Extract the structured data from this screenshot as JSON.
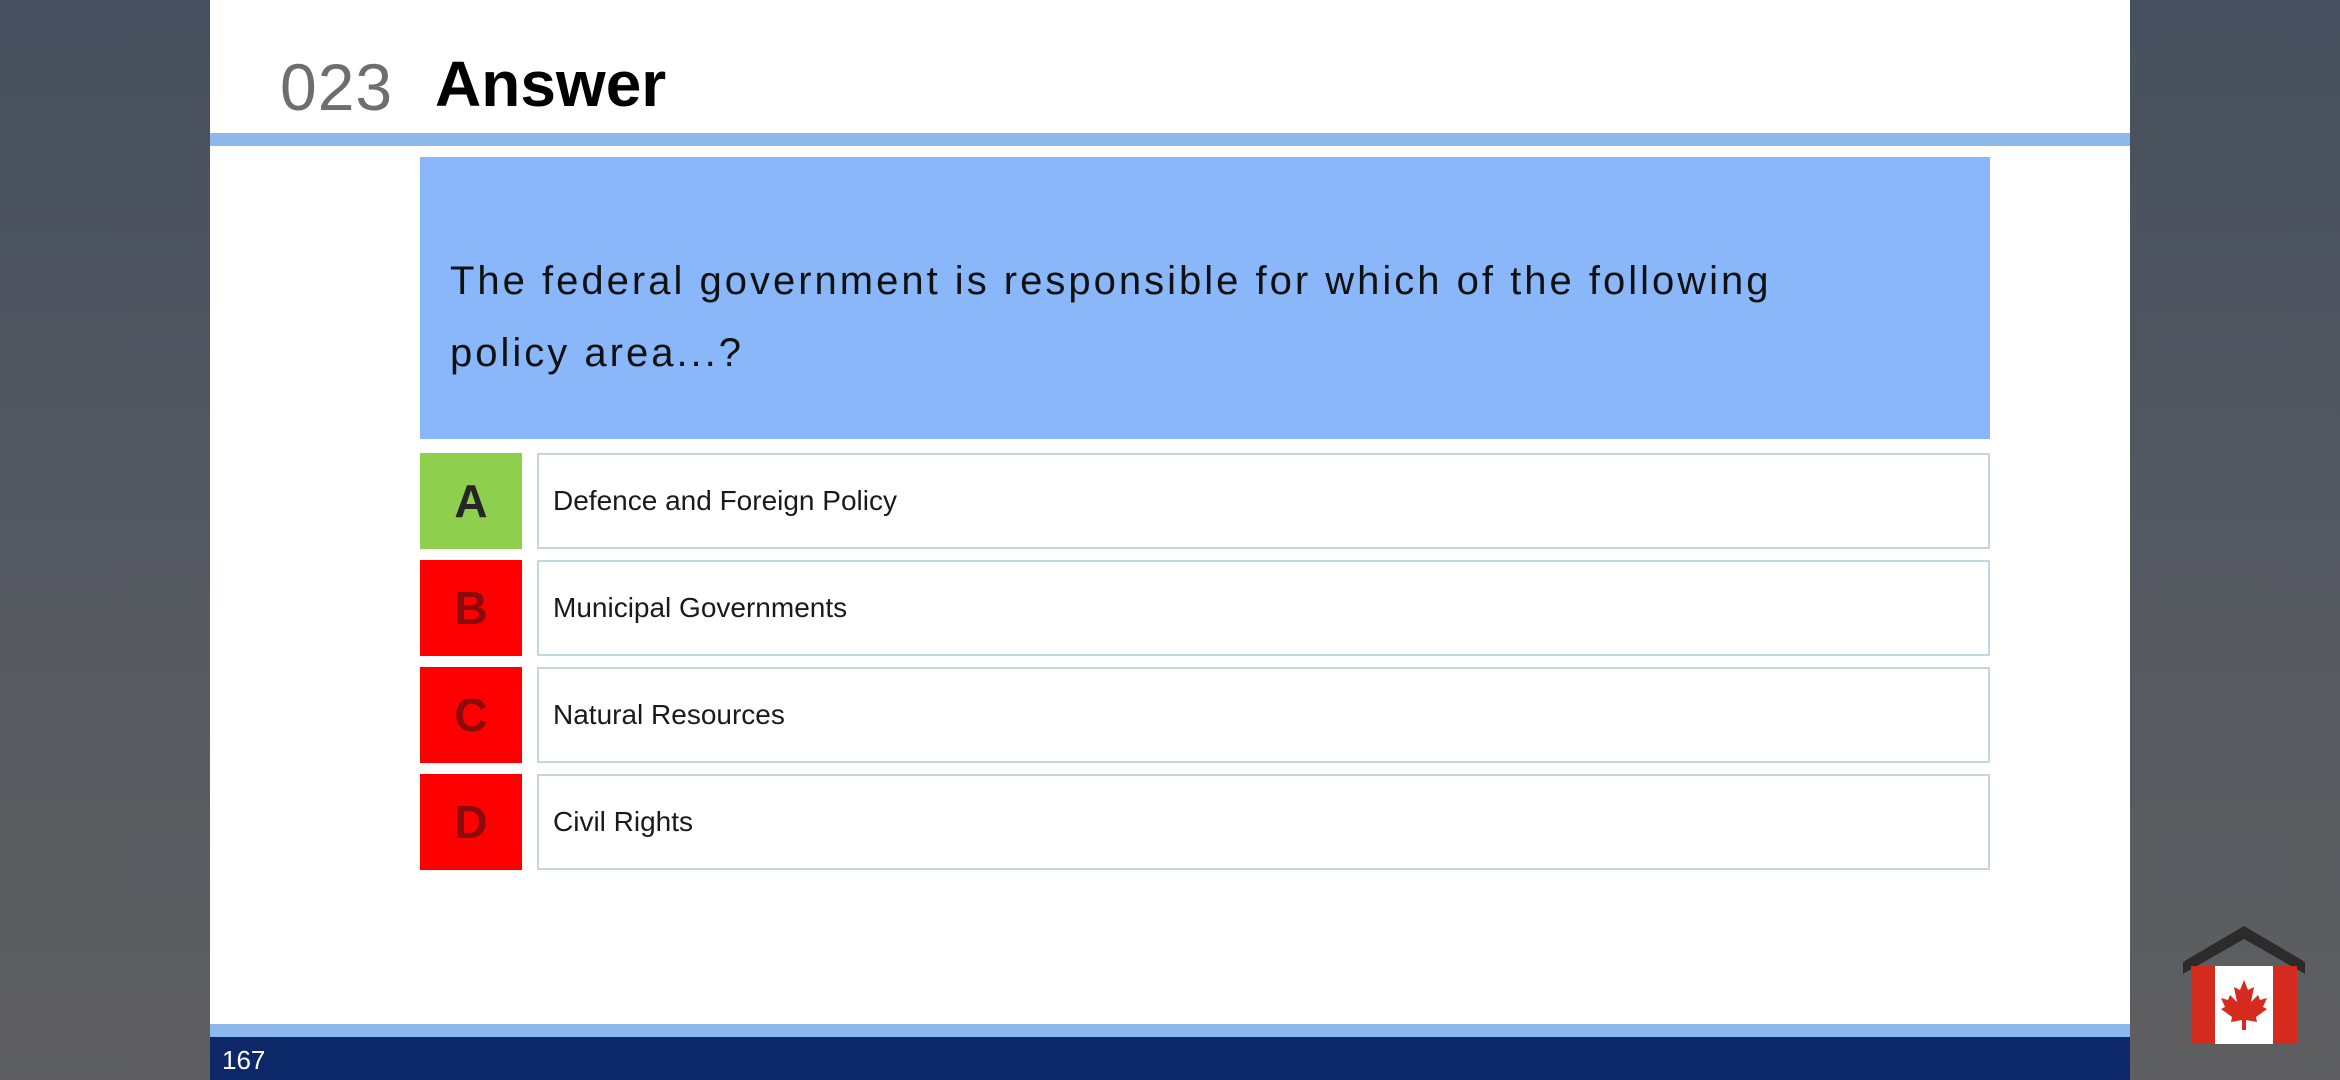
{
  "slide": {
    "number": "023",
    "title": "Answer",
    "question": "The federal government is responsible for which of the following policy area...?",
    "options": [
      {
        "letter": "A",
        "text": "Defence and Foreign Policy",
        "status": "correct"
      },
      {
        "letter": "B",
        "text": "Municipal Governments",
        "status": "wrong"
      },
      {
        "letter": "C",
        "text": "Natural Resources",
        "status": "wrong"
      },
      {
        "letter": "D",
        "text": "Civil Rights",
        "status": "wrong"
      }
    ],
    "page_number": "167"
  },
  "colors": {
    "correct": "#8fcf4e",
    "wrong": "#ff0000",
    "question_bg": "#8ab7fa",
    "footer_bg": "#0c2869",
    "rule": "#8db8ec"
  },
  "logo": {
    "icon": "canada-flag-house-icon"
  }
}
